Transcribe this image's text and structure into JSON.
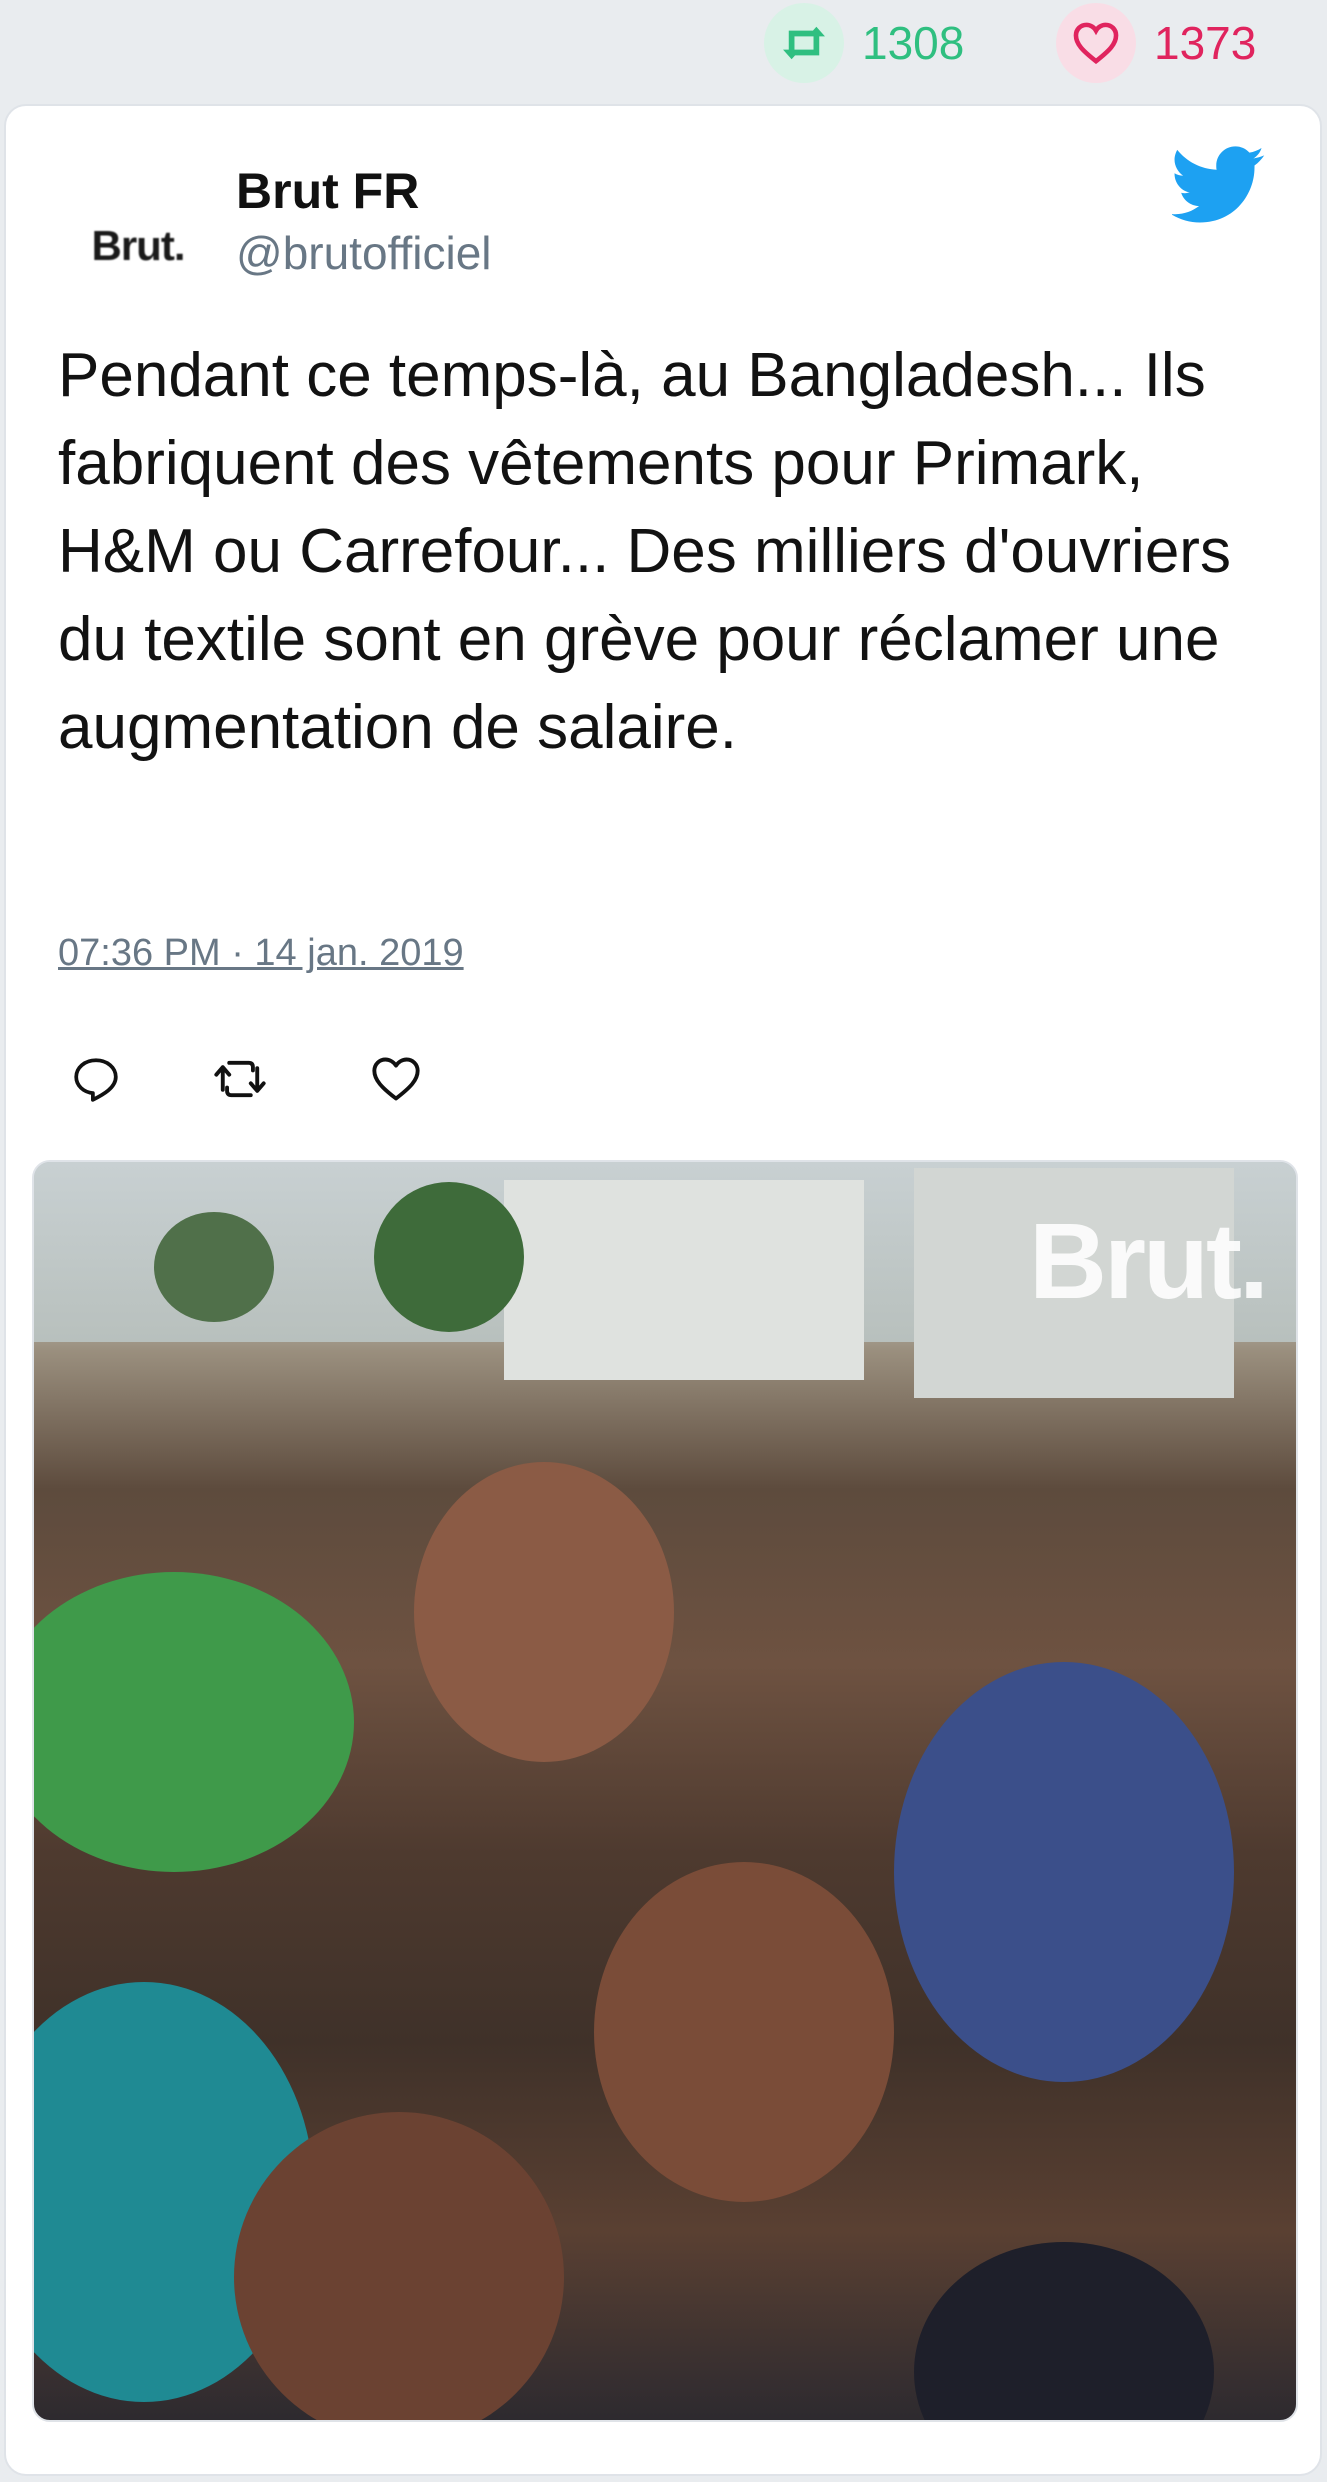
{
  "stats": {
    "retweets": "1308",
    "likes": "1373",
    "retweet_icon": "retweet-icon",
    "like_icon": "heart-icon"
  },
  "tweet": {
    "author_name": "Brut FR",
    "author_handle": "@brutofficiel",
    "avatar_text": "Brut.",
    "text": "Pendant ce temps-là, au Bangladesh... Ils fabriquent des vêtements pour Primark, H&M ou Carrefour... Des milliers d'ouvriers du textile sont en grève pour réclamer une augmentation de salaire.",
    "timestamp": "07:36 PM · 14 jan. 2019",
    "media_watermark": "Brut."
  },
  "actions": [
    {
      "name": "reply",
      "icon": "reply-icon"
    },
    {
      "name": "retweet",
      "icon": "retweet-icon"
    },
    {
      "name": "like",
      "icon": "heart-icon"
    }
  ],
  "colors": {
    "retweet": "#2fbf80",
    "like": "#e0245e",
    "twitter_blue": "#1da1f2",
    "muted": "#687785"
  }
}
